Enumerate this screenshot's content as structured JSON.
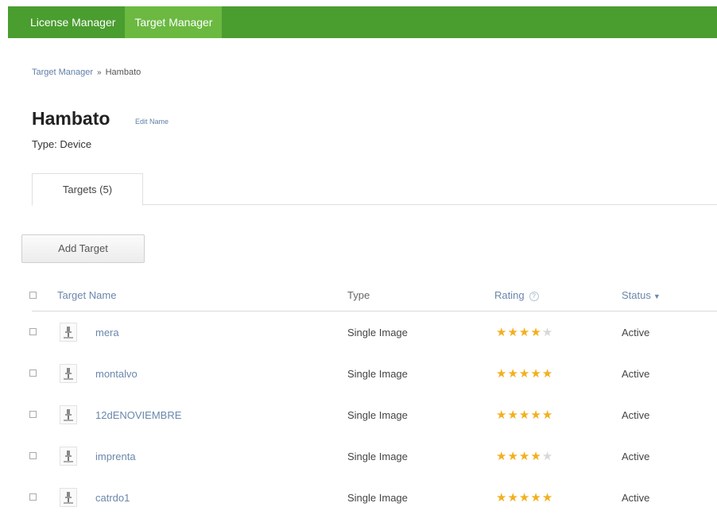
{
  "nav": {
    "items": [
      {
        "label": "License Manager",
        "active": false
      },
      {
        "label": "Target Manager",
        "active": true
      }
    ],
    "color": "#4a9d2f",
    "active_color": "#6bb941"
  },
  "breadcrumb": {
    "parent": "Target Manager",
    "separator": "»",
    "current": "Hambato"
  },
  "header": {
    "title": "Hambato",
    "edit_label": "Edit Name",
    "type_label": "Type:",
    "type_value": "Device"
  },
  "tabs": [
    {
      "label": "Targets (5)",
      "active": true
    }
  ],
  "add_target_label": "Add Target",
  "table": {
    "columns": {
      "name": "Target Name",
      "type": "Type",
      "rating": "Rating",
      "status": "Status"
    },
    "rows": [
      {
        "name": "mera",
        "type": "Single Image",
        "rating": 4,
        "status": "Active"
      },
      {
        "name": "montalvo",
        "type": "Single Image",
        "rating": 5,
        "status": "Active"
      },
      {
        "name": "12dENOVIEMBRE",
        "type": "Single Image",
        "rating": 5,
        "status": "Active"
      },
      {
        "name": "imprenta",
        "type": "Single Image",
        "rating": 4,
        "status": "Active"
      },
      {
        "name": "catrdo1",
        "type": "Single Image",
        "rating": 5,
        "status": "Active"
      }
    ],
    "rating_max": 5,
    "star_color": "#f2b01e"
  }
}
